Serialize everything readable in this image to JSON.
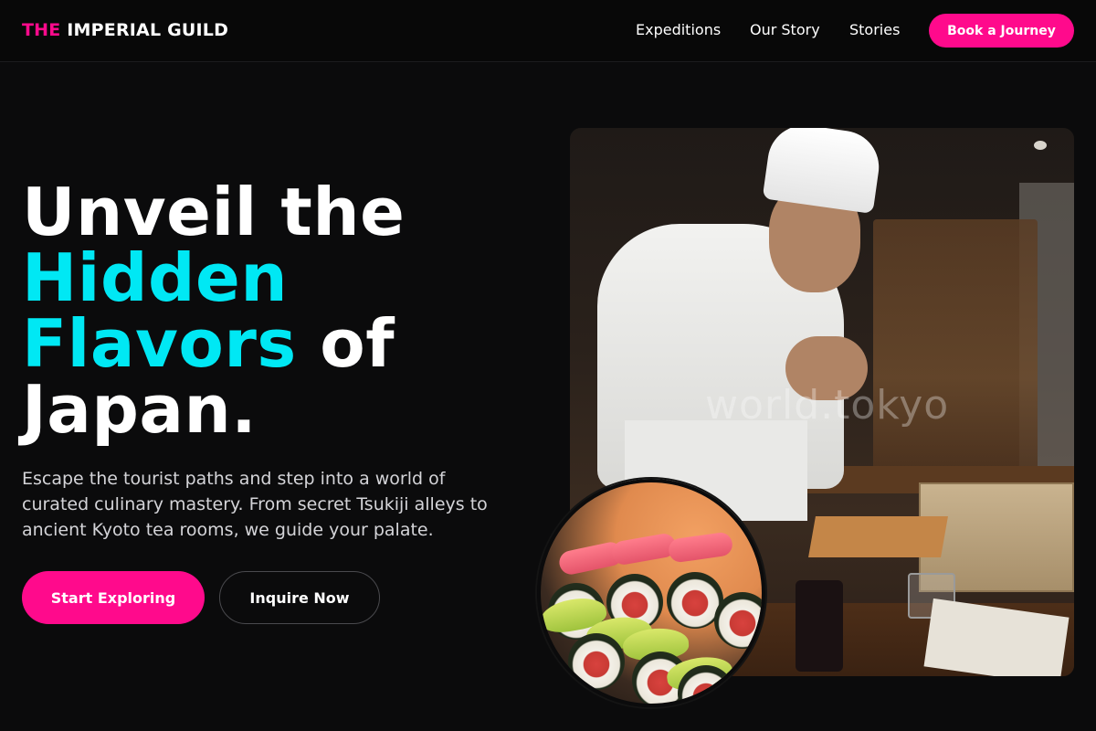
{
  "nav": {
    "brand_accent": "THE",
    "brand_rest": "IMPERIAL GUILD",
    "links": [
      "Expeditions",
      "Our Story",
      "Stories"
    ],
    "cta_label": "Book a Journey"
  },
  "hero": {
    "headline": {
      "line1": "Unveil the",
      "line2": "Hidden",
      "line3_accent": "Flavors",
      "line3_rest": " of",
      "line4": "Japan."
    },
    "description": "Escape the tourist paths and step into a world of curated culinary mastery. From secret Tsukiji alleys to ancient Kyoto tea rooms, we guide your palate.",
    "primary_button": "Start Exploring",
    "secondary_button": "Inquire Now",
    "photo_watermark": "world.tokyo"
  },
  "colors": {
    "accent_pink": "#ff0a8c",
    "accent_cyan": "#00e8f4",
    "background": "#0b0b0c"
  },
  "icons": {
    "photo_main": "sushi-chef-photo",
    "photo_inset": "sushi-rolls-photo"
  }
}
